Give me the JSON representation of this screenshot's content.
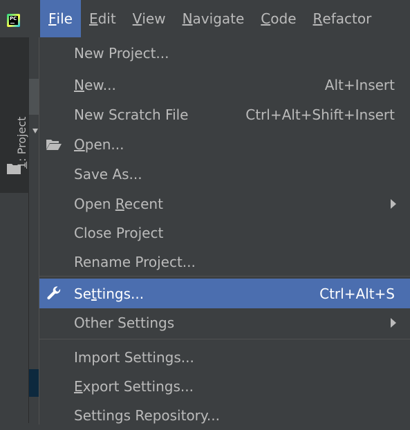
{
  "app": {
    "logo_text": "PC"
  },
  "menubar": {
    "items": [
      {
        "pre": "",
        "mn": "F",
        "post": "ile"
      },
      {
        "pre": "",
        "mn": "E",
        "post": "dit"
      },
      {
        "pre": "",
        "mn": "V",
        "post": "iew"
      },
      {
        "pre": "",
        "mn": "N",
        "post": "avigate"
      },
      {
        "pre": "",
        "mn": "C",
        "post": "ode"
      },
      {
        "pre": "",
        "mn": "R",
        "post": "efactor"
      }
    ]
  },
  "toolwindow": {
    "project_tab": {
      "mn": "1",
      "post": ": Project"
    }
  },
  "file_menu": {
    "items": [
      {
        "pre": "New Project...",
        "mn": "",
        "post": "",
        "shortcut": ""
      },
      {
        "pre": "",
        "mn": "N",
        "post": "ew...",
        "shortcut": "Alt+Insert"
      },
      {
        "pre": "New Scratch File",
        "mn": "",
        "post": "",
        "shortcut": "Ctrl+Alt+Shift+Insert"
      },
      {
        "pre": "",
        "mn": "O",
        "post": "pen...",
        "shortcut": ""
      },
      {
        "pre": "Save As...",
        "mn": "",
        "post": "",
        "shortcut": ""
      },
      {
        "pre": "Open ",
        "mn": "R",
        "post": "ecent",
        "shortcut": ""
      },
      {
        "pre": "Close Pro",
        "mn": "j",
        "post": "ect",
        "shortcut": ""
      },
      {
        "pre": "Rename Project...",
        "mn": "",
        "post": "",
        "shortcut": ""
      },
      {
        "pre": "Se",
        "mn": "t",
        "post": "tings...",
        "shortcut": "Ctrl+Alt+S"
      },
      {
        "pre": "Other Settings",
        "mn": "",
        "post": "",
        "shortcut": ""
      },
      {
        "pre": "Import Settings...",
        "mn": "",
        "post": "",
        "shortcut": ""
      },
      {
        "pre": "",
        "mn": "E",
        "post": "xport Settings...",
        "shortcut": ""
      },
      {
        "pre": "Settings Repository...",
        "mn": "",
        "post": "",
        "shortcut": ""
      }
    ],
    "selected_item": "Settings...",
    "icons": {
      "open": "folder-open-icon",
      "settings": "wrench-icon",
      "submenu": "chevron-right-icon"
    }
  },
  "colors": {
    "background": "#3c3f41",
    "selection": "#4b6eaf",
    "text": "#bbbbbb",
    "separator": "#515151"
  }
}
